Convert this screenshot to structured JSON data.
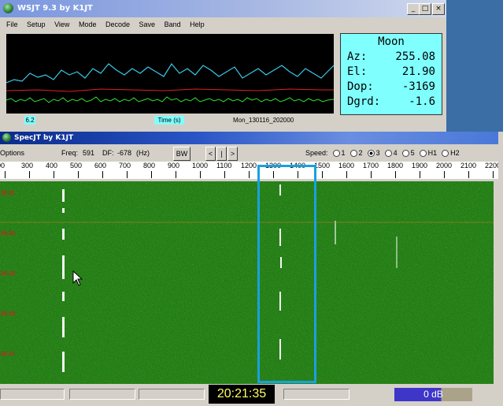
{
  "wsjt": {
    "title": "WSJT 9.3    by K1JT",
    "menu": [
      "File",
      "Setup",
      "View",
      "Mode",
      "Decode",
      "Save",
      "Band",
      "Help"
    ],
    "plot_label_left": "6.2",
    "plot_label_time": "Time (s)",
    "plot_file": "Mon_130116_202000",
    "moon": {
      "title": "Moon",
      "rows": [
        {
          "k": "Az:",
          "v": "255.08"
        },
        {
          "k": "El:",
          "v": "21.90"
        },
        {
          "k": "Dop:",
          "v": "-3169"
        },
        {
          "k": "Dgrd:",
          "v": "-1.6"
        }
      ]
    },
    "window_buttons": [
      "_",
      "□",
      "×"
    ]
  },
  "specjt": {
    "title": "SpecJT    by K1JT",
    "options": "Options",
    "freq_label": "Freq:",
    "freq_value": "591",
    "df_label": "DF:",
    "df_value": "-678",
    "df_unit": "(Hz)",
    "bw_button": "BW",
    "nav_buttons": [
      "<",
      "|",
      ">"
    ],
    "speed_label": "Speed:",
    "speed_options": [
      "1",
      "2",
      "3",
      "4",
      "5",
      "H1",
      "H2"
    ],
    "speed_selected": "3",
    "scale_ticks": [
      "00",
      "300",
      "400",
      "500",
      "600",
      "700",
      "800",
      "900",
      "1000",
      "1100",
      "1200",
      "1300",
      "1400",
      "1500",
      "1600",
      "1700",
      "1800",
      "1900",
      "2000",
      "2100",
      "2200"
    ],
    "time_marks": [
      "20:21",
      "20:20",
      "20:19",
      "20:18",
      "20:17"
    ],
    "clock": "20:21:35",
    "level": "0 dB"
  }
}
